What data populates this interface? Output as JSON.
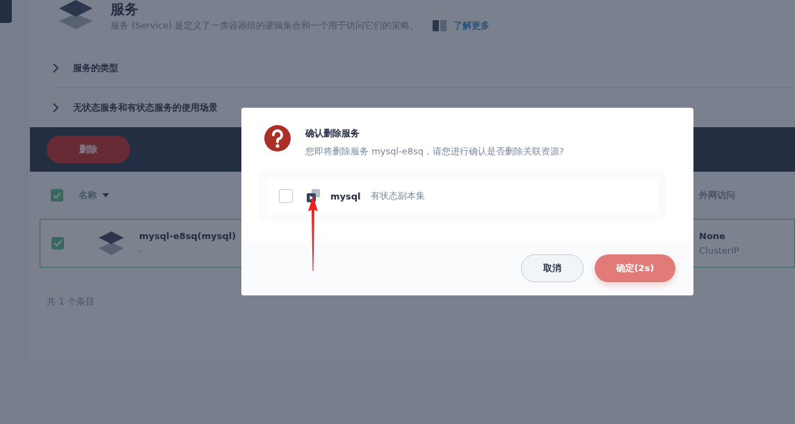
{
  "page": {
    "title": "服务",
    "description": "服务 (Service) 是定义了一类容器组的逻辑集合和一个用于访问它们的策略。",
    "learn_more": "了解更多"
  },
  "sections": [
    {
      "label": "服务的类型",
      "expanded": false
    },
    {
      "label": "无状态服务和有状态服务的使用场景",
      "expanded": false
    }
  ],
  "toolbar": {
    "delete_button": "删除"
  },
  "table": {
    "header_checked": true,
    "columns": [
      {
        "label": "名称",
        "sortable": true
      },
      {
        "label": "外网访问"
      }
    ],
    "rows": [
      {
        "name": "mysql-e8sq(mysql)",
        "description": "-",
        "external_access": "None",
        "service_type": "ClusterIP",
        "checked": true
      }
    ]
  },
  "footer": "共 1 个条目",
  "dialog": {
    "title": "确认删除服务",
    "message": "您即将删除服务 mysql-e8sq，请您进行确认是否删除关联资源?",
    "resources": [
      {
        "name": "mysql",
        "type": "有状态副本集",
        "checked": false
      }
    ],
    "buttons": [
      {
        "label": "取消",
        "kind": "secondary"
      },
      {
        "label": "确定(2s)",
        "kind": "primary"
      }
    ]
  }
}
